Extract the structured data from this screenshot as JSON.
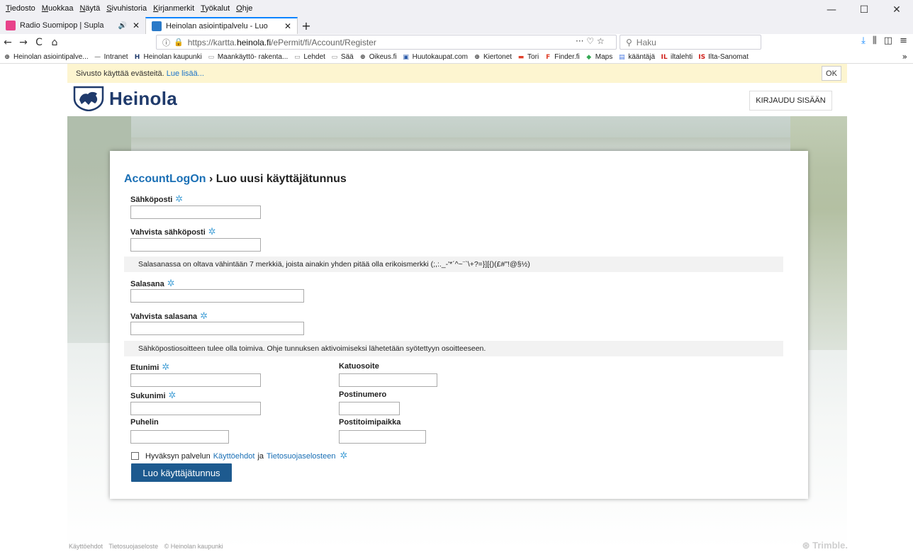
{
  "menu": [
    "Tiedosto",
    "Muokkaa",
    "Näytä",
    "Sivuhistoria",
    "Kirjanmerkit",
    "Työkalut",
    "Ohje"
  ],
  "window_controls": {
    "minimize": "—",
    "maximize": "☐",
    "close": "✕"
  },
  "tabs": [
    {
      "label": "Radio Suomipop | Supla",
      "color": "#e8428a",
      "audio": "🔊"
    },
    {
      "label": "Heinolan asiointipalvelu - Luo",
      "color": "#2a7ac8"
    }
  ],
  "tab_close": "✕",
  "new_tab": "+",
  "nav": {
    "back": "←",
    "forward": "→",
    "reload": "C",
    "home": "⌂"
  },
  "url": {
    "prefix": "https://kartta.",
    "domain": "heinola.fi",
    "path": "/ePermit/fi/Account/Register",
    "actions": "··· ♡ ☆"
  },
  "search": {
    "placeholder": "Haku"
  },
  "bookmarks": [
    {
      "label": "Heinolan asiointipalve...",
      "icon": "⊕",
      "color": "#333"
    },
    {
      "label": "Intranet",
      "icon": "—",
      "color": "#999"
    },
    {
      "label": "Heinolan kaupunki",
      "icon": "H",
      "color": "#1f3a6b"
    },
    {
      "label": "Maankäyttö- rakenta...",
      "icon": "▭",
      "color": "#888"
    },
    {
      "label": "Lehdet",
      "icon": "▭",
      "color": "#888"
    },
    {
      "label": "Sää",
      "icon": "▭",
      "color": "#888"
    },
    {
      "label": "Oikeus.fi",
      "icon": "⊕",
      "color": "#333"
    },
    {
      "label": "Huutokaupat.com",
      "icon": "▣",
      "color": "#2a5aa8"
    },
    {
      "label": "Kiertonet",
      "icon": "⊕",
      "color": "#333"
    },
    {
      "label": "Tori",
      "icon": "▬",
      "color": "#e0402a"
    },
    {
      "label": "Finder.fi",
      "icon": "F",
      "color": "#e0402a"
    },
    {
      "label": "Maps",
      "icon": "◆",
      "color": "#34a853"
    },
    {
      "label": "kääntäjä",
      "icon": "▤",
      "color": "#4a7ae0"
    },
    {
      "label": "iltalehti",
      "icon": "IL",
      "color": "#d0201a"
    },
    {
      "label": "Ilta-Sanomat",
      "icon": "IS",
      "color": "#d0201a"
    }
  ],
  "bookmarks_more": "»",
  "cookie": {
    "text": "Sivusto käyttää evästeitä.",
    "link": "Lue lisää...",
    "ok": "OK"
  },
  "brand": {
    "name": "Heinola",
    "color": "#1f3a6b"
  },
  "login_button": "KIRJAUDU SISÄÄN",
  "form": {
    "breadcrumb": "AccountLogOn",
    "separator": "›",
    "title": "Luo uusi käyttäjätunnus",
    "required_mark": "✲",
    "email_label": "Sähköposti",
    "email_confirm_label": "Vahvista sähköposti",
    "password_hint": "Salasanassa on oltava vähintään 7 merkkiä, joista ainakin yhden pitää olla erikoismerkki (;,:._-'*´^~¨`\\+?=}][{)(£#\"!@§½)",
    "password_label": "Salasana",
    "password_confirm_label": "Vahvista salasana",
    "email_hint": "Sähköpostiosoitteen tulee olla toimiva. Ohje tunnuksen aktivoimiseksi lähetetään syötettyyn osoitteeseen.",
    "firstname_label": "Etunimi",
    "lastname_label": "Sukunimi",
    "phone_label": "Puhelin",
    "street_label": "Katuosoite",
    "postal_code_label": "Postinumero",
    "city_label": "Postitoimipaikka",
    "terms_prefix": "Hyväksyn palvelun",
    "terms_link": "Käyttöehdot",
    "terms_and": "ja",
    "privacy_link": "Tietosuojaselosteen",
    "submit": "Luo käyttäjätunnus"
  },
  "footer": {
    "terms": "Käyttöehdot",
    "privacy": "Tietosuojaseloste",
    "copyright": "© Heinolan kaupunki",
    "vendor": "⊛ Trimble."
  }
}
